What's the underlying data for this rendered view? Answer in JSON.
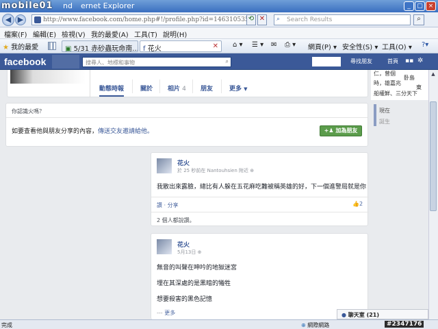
{
  "window": {
    "watermark": "mobile01",
    "title": "ernet Explorer",
    "title_prefix": "nd"
  },
  "address_bar": {
    "url": "http://www.facebook.com/home.php#!/profile.php?id=1463105354&",
    "search_placeholder": "Search Results"
  },
  "menu": [
    "檔案(F)",
    "編輯(E)",
    "檢視(V)",
    "我的最愛(A)",
    "工具(T)",
    "說明(H)"
  ],
  "favorites": {
    "label": "我的最愛",
    "tabs": [
      "5/31 赤砂蟲玩命南...",
      "花火"
    ],
    "tools": [
      "網頁(P)",
      "安全性(S)",
      "工具(O)"
    ]
  },
  "facebook": {
    "logo": "facebook",
    "search_placeholder": "搜尋人、地標和事物",
    "nav": [
      "尋找朋友",
      "首頁"
    ],
    "profile_name": "花火",
    "timeline_tabs": [
      {
        "label": "動態時報"
      },
      {
        "label": "關於"
      },
      {
        "label": "相片",
        "count": "4"
      },
      {
        "label": "朋友"
      },
      {
        "label": "更多"
      }
    ],
    "right_panel": {
      "snippet": [
        "仁，曾個",
        "卧島",
        "時，雄嘉兆",
        "東",
        "船權鮮、三分天下"
      ],
      "timeline_nav": [
        "現在",
        "誕生"
      ]
    },
    "friend_box": {
      "question": "你認識火嗎？",
      "body": "如要查看他與朋友分享的內容，",
      "link": "傳送交友邀請給他。",
      "button": "加為朋友"
    },
    "posts": [
      {
        "author": "花火",
        "meta": "於 25 秒前在 Nantouhsien 附近",
        "lines": [
          "我散出來露臉，總比有人躲在五花麻吃難被稱英雄的好，下一個進警局就是你"
        ],
        "actions": "讚 · 分享",
        "likes": "2",
        "footer": "2 個人都說讚。"
      },
      {
        "author": "花火",
        "meta": "5月13日",
        "lines": [
          "無音的叫聲在呻吟的地獄迷宮",
          "埋在其深處的是黑暗的犧牲",
          "想要殺害的黑色記憶"
        ],
        "more": "更多"
      }
    ],
    "chat": "聊天室 (21)"
  },
  "status_bar": {
    "left": "完成",
    "zone": "網際網路",
    "zoom": "#2347176"
  },
  "colors": {
    "fb_blue": "#3b5998",
    "add_friend_green": "#5b9c4b"
  }
}
